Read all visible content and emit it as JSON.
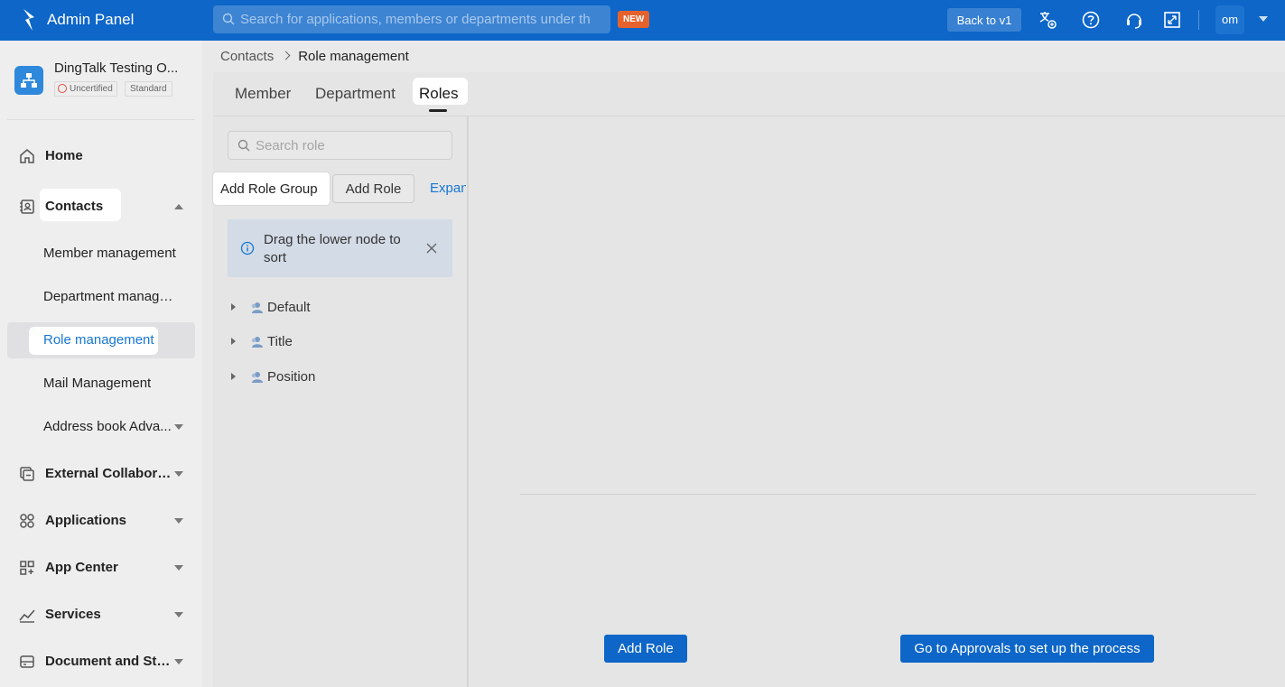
{
  "topbar": {
    "title": "Admin Panel",
    "search_placeholder": "Search for applications, members or departments under th",
    "new_badge": "NEW",
    "back_button": "Back to v1",
    "avatar": "om",
    "icons": [
      "translate-icon",
      "help-icon",
      "headset-icon",
      "fullscreen-icon"
    ]
  },
  "sidebar": {
    "org_name": "DingTalk Testing O...",
    "badge_uncertified": "Uncertified",
    "badge_standard": "Standard",
    "items": [
      {
        "label": "Home"
      },
      {
        "label": "Contacts"
      },
      {
        "label": "External Collabora..."
      },
      {
        "label": "Applications"
      },
      {
        "label": "App Center"
      },
      {
        "label": "Services"
      },
      {
        "label": "Document and Sto..."
      }
    ],
    "contacts_sub": [
      {
        "label": "Member management"
      },
      {
        "label": "Department manage..."
      },
      {
        "label": "Role management"
      },
      {
        "label": "Mail Management"
      },
      {
        "label": "Address book Adva..."
      }
    ]
  },
  "breadcrumb": {
    "root": "Contacts",
    "current": "Role management"
  },
  "tabs": [
    {
      "label": "Member"
    },
    {
      "label": "Department"
    },
    {
      "label": "Roles",
      "active": true
    }
  ],
  "roles_panel": {
    "search_placeholder": "Search role",
    "add_role_group": "Add Role Group",
    "add_role": "Add Role",
    "expand": "Expan",
    "info_text": "Drag the lower node to sort",
    "tree": [
      {
        "label": "Default"
      },
      {
        "label": "Title"
      },
      {
        "label": "Position"
      }
    ]
  },
  "main_actions": {
    "add_role": "Add Role",
    "approvals": "Go to Approvals to set up the process"
  },
  "colors": {
    "brand": "#0d66c8",
    "link": "#1677d2",
    "new_badge": "#e6622c"
  }
}
